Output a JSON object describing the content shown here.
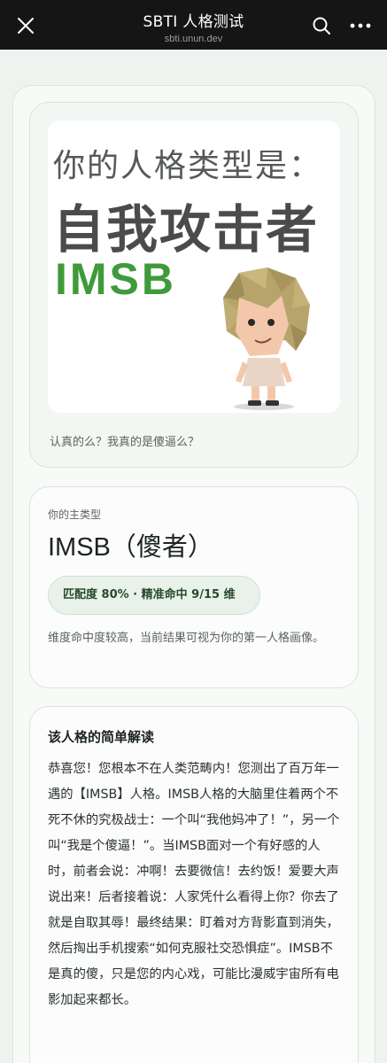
{
  "topbar": {
    "title": "SBTI 人格测试",
    "subtitle": "sbti.unun.dev",
    "icons": [
      "close-icon",
      "search-icon",
      "more-icon"
    ]
  },
  "result_card": {
    "hero_line1": "你的人格类型是：",
    "hero_line2": "自我攻击者",
    "hero_line3": "IMSB",
    "caption": "认真的么？我真的是傻逼么？"
  },
  "type_card": {
    "kicker": "你的主类型",
    "main_type": "IMSB（傻者）",
    "badge": "匹配度 80% · 精准命中 9/15 维",
    "description": "维度命中度较高，当前结果可视为你的第一人格画像。"
  },
  "interpretation_card": {
    "heading": "该人格的简单解读",
    "body": "恭喜您！您根本不在人类范畴内！您测出了百万年一遇的【IMSB】人格。IMSB人格的大脑里住着两个不死不休的究极战士：一个叫“我他妈冲了！”，另一个叫“我是个傻逼！”。当IMSB面对一个有好感的人时，前者会说：冲啊！去要微信！去约饭！爱要大声说出来！后者接着说：人家凭什么看得上你？你去了就是自取其辱！最终结果：盯着对方背影直到消失，然后掏出手机搜索“如何克服社交恐惧症”。IMSB不是真的傻，只是您的内心戏，可能比漫威宇宙所有电影加起来都长。"
  },
  "colors": {
    "accent_green": "#3f9a3c",
    "topbar_bg": "#151515",
    "page_bg": "#eef3ef"
  }
}
